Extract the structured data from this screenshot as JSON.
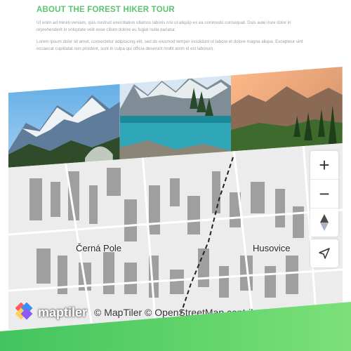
{
  "about": {
    "title": "ABOUT THE FOREST HIKER TOUR",
    "paragraph1": "Ut enim ad minim veniam, quis nostrud exercitation ullamco laboris nisi ut aliquip ex ea commodo consequat. Duis aute irure dolor in reprehenderit in voluptate velit esse cillum dolore eu fugiat nulla pariatur.",
    "paragraph2": "Lorem ipsum dolor sit amet, consectetur adipisicing elit, sed do eiusmod tempor incididunt ut labore et dolore magna aliqua. Excepteur sint occaecat cupidatat non proident, sunt in culpa qui officia deserunt mollit anim id est laborum."
  },
  "photos": [
    {
      "name": "snowy-mountain-photo"
    },
    {
      "name": "mountain-lake-photo"
    },
    {
      "name": "forest-valley-photo"
    }
  ],
  "map": {
    "labels": [
      "Černá Pole",
      "Husovice"
    ],
    "attribution": "© MapTiler © OpenStreetMap contrib...",
    "logo_text": "maptiler",
    "controls": {
      "zoom_in": "+",
      "zoom_out": "−"
    }
  },
  "colors": {
    "accent": "#5cc46d",
    "band_start": "#43c45f",
    "band_end": "#7ce07a"
  }
}
